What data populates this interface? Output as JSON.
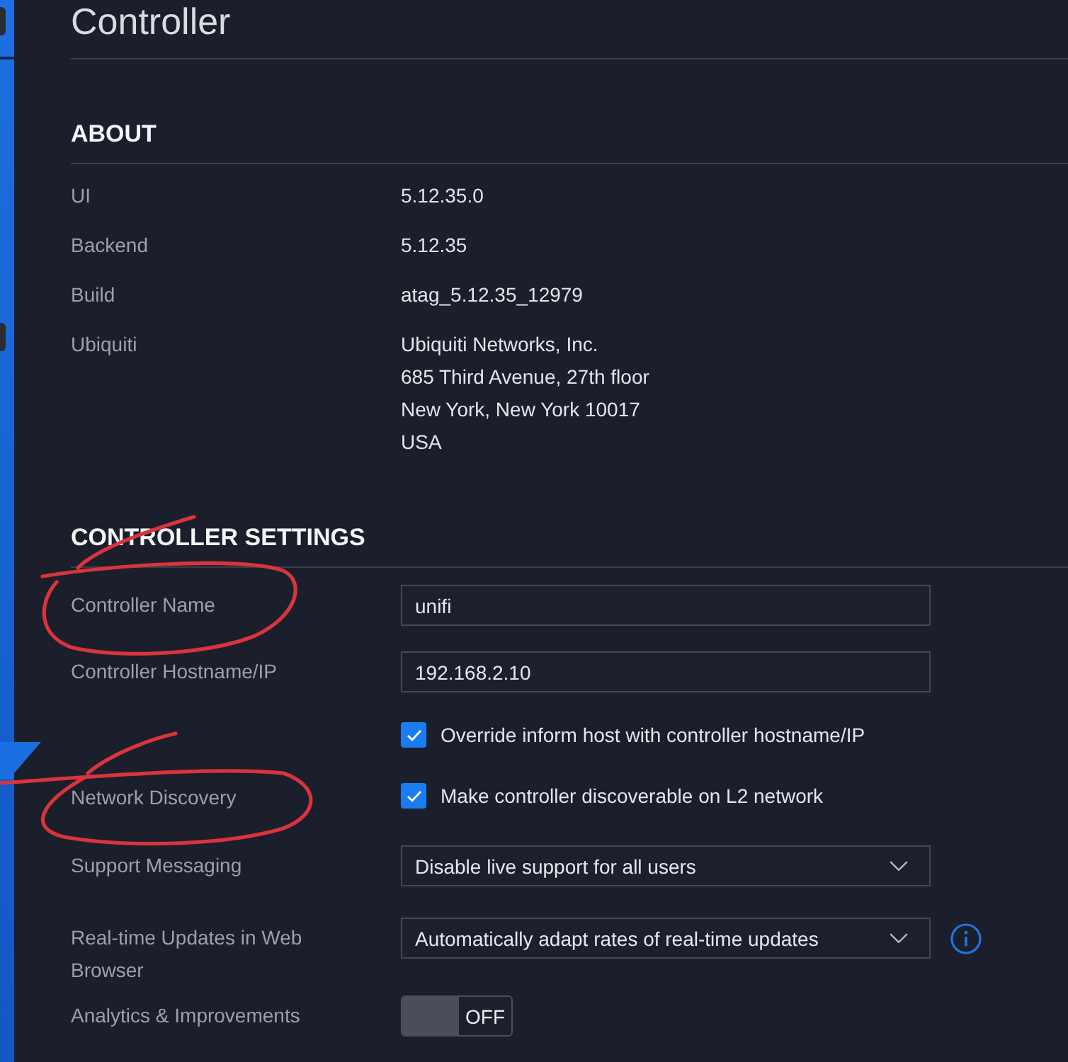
{
  "title": "Controller",
  "about": {
    "heading": "ABOUT",
    "rows": [
      {
        "label": "UI",
        "value_lines": [
          "5.12.35.0"
        ]
      },
      {
        "label": "Backend",
        "value_lines": [
          "5.12.35"
        ]
      },
      {
        "label": "Build",
        "value_lines": [
          "atag_5.12.35_12979"
        ]
      },
      {
        "label": "Ubiquiti",
        "value_lines": [
          "Ubiquiti Networks, Inc.",
          "685 Third Avenue, 27th floor",
          "New York, New York 10017",
          "USA"
        ]
      }
    ]
  },
  "settings": {
    "heading": "CONTROLLER SETTINGS",
    "rows": [
      {
        "kind": "text",
        "label": "Controller Name",
        "value": "unifi",
        "circled": true
      },
      {
        "kind": "text",
        "label": "Controller Hostname/IP",
        "value": "192.168.2.10",
        "circled": false
      },
      {
        "kind": "checkbox",
        "text": "Override inform host with controller hostname/IP",
        "checked": true,
        "circled": false
      },
      {
        "kind": "checkbox",
        "label": "Network Discovery",
        "text": "Make controller discoverable on L2 network",
        "checked": true,
        "circled": true
      },
      {
        "kind": "select",
        "label": "Support Messaging",
        "value": "Disable live support for all users",
        "info": false,
        "circled": false
      },
      {
        "kind": "select",
        "label": "Real-time Updates in Web Browser",
        "value": "Automatically adapt rates of real-time updates",
        "info": true,
        "circled": false
      },
      {
        "kind": "toggle",
        "label": "Analytics & Improvements",
        "on": false,
        "text": "OFF",
        "circled": false
      }
    ]
  }
}
